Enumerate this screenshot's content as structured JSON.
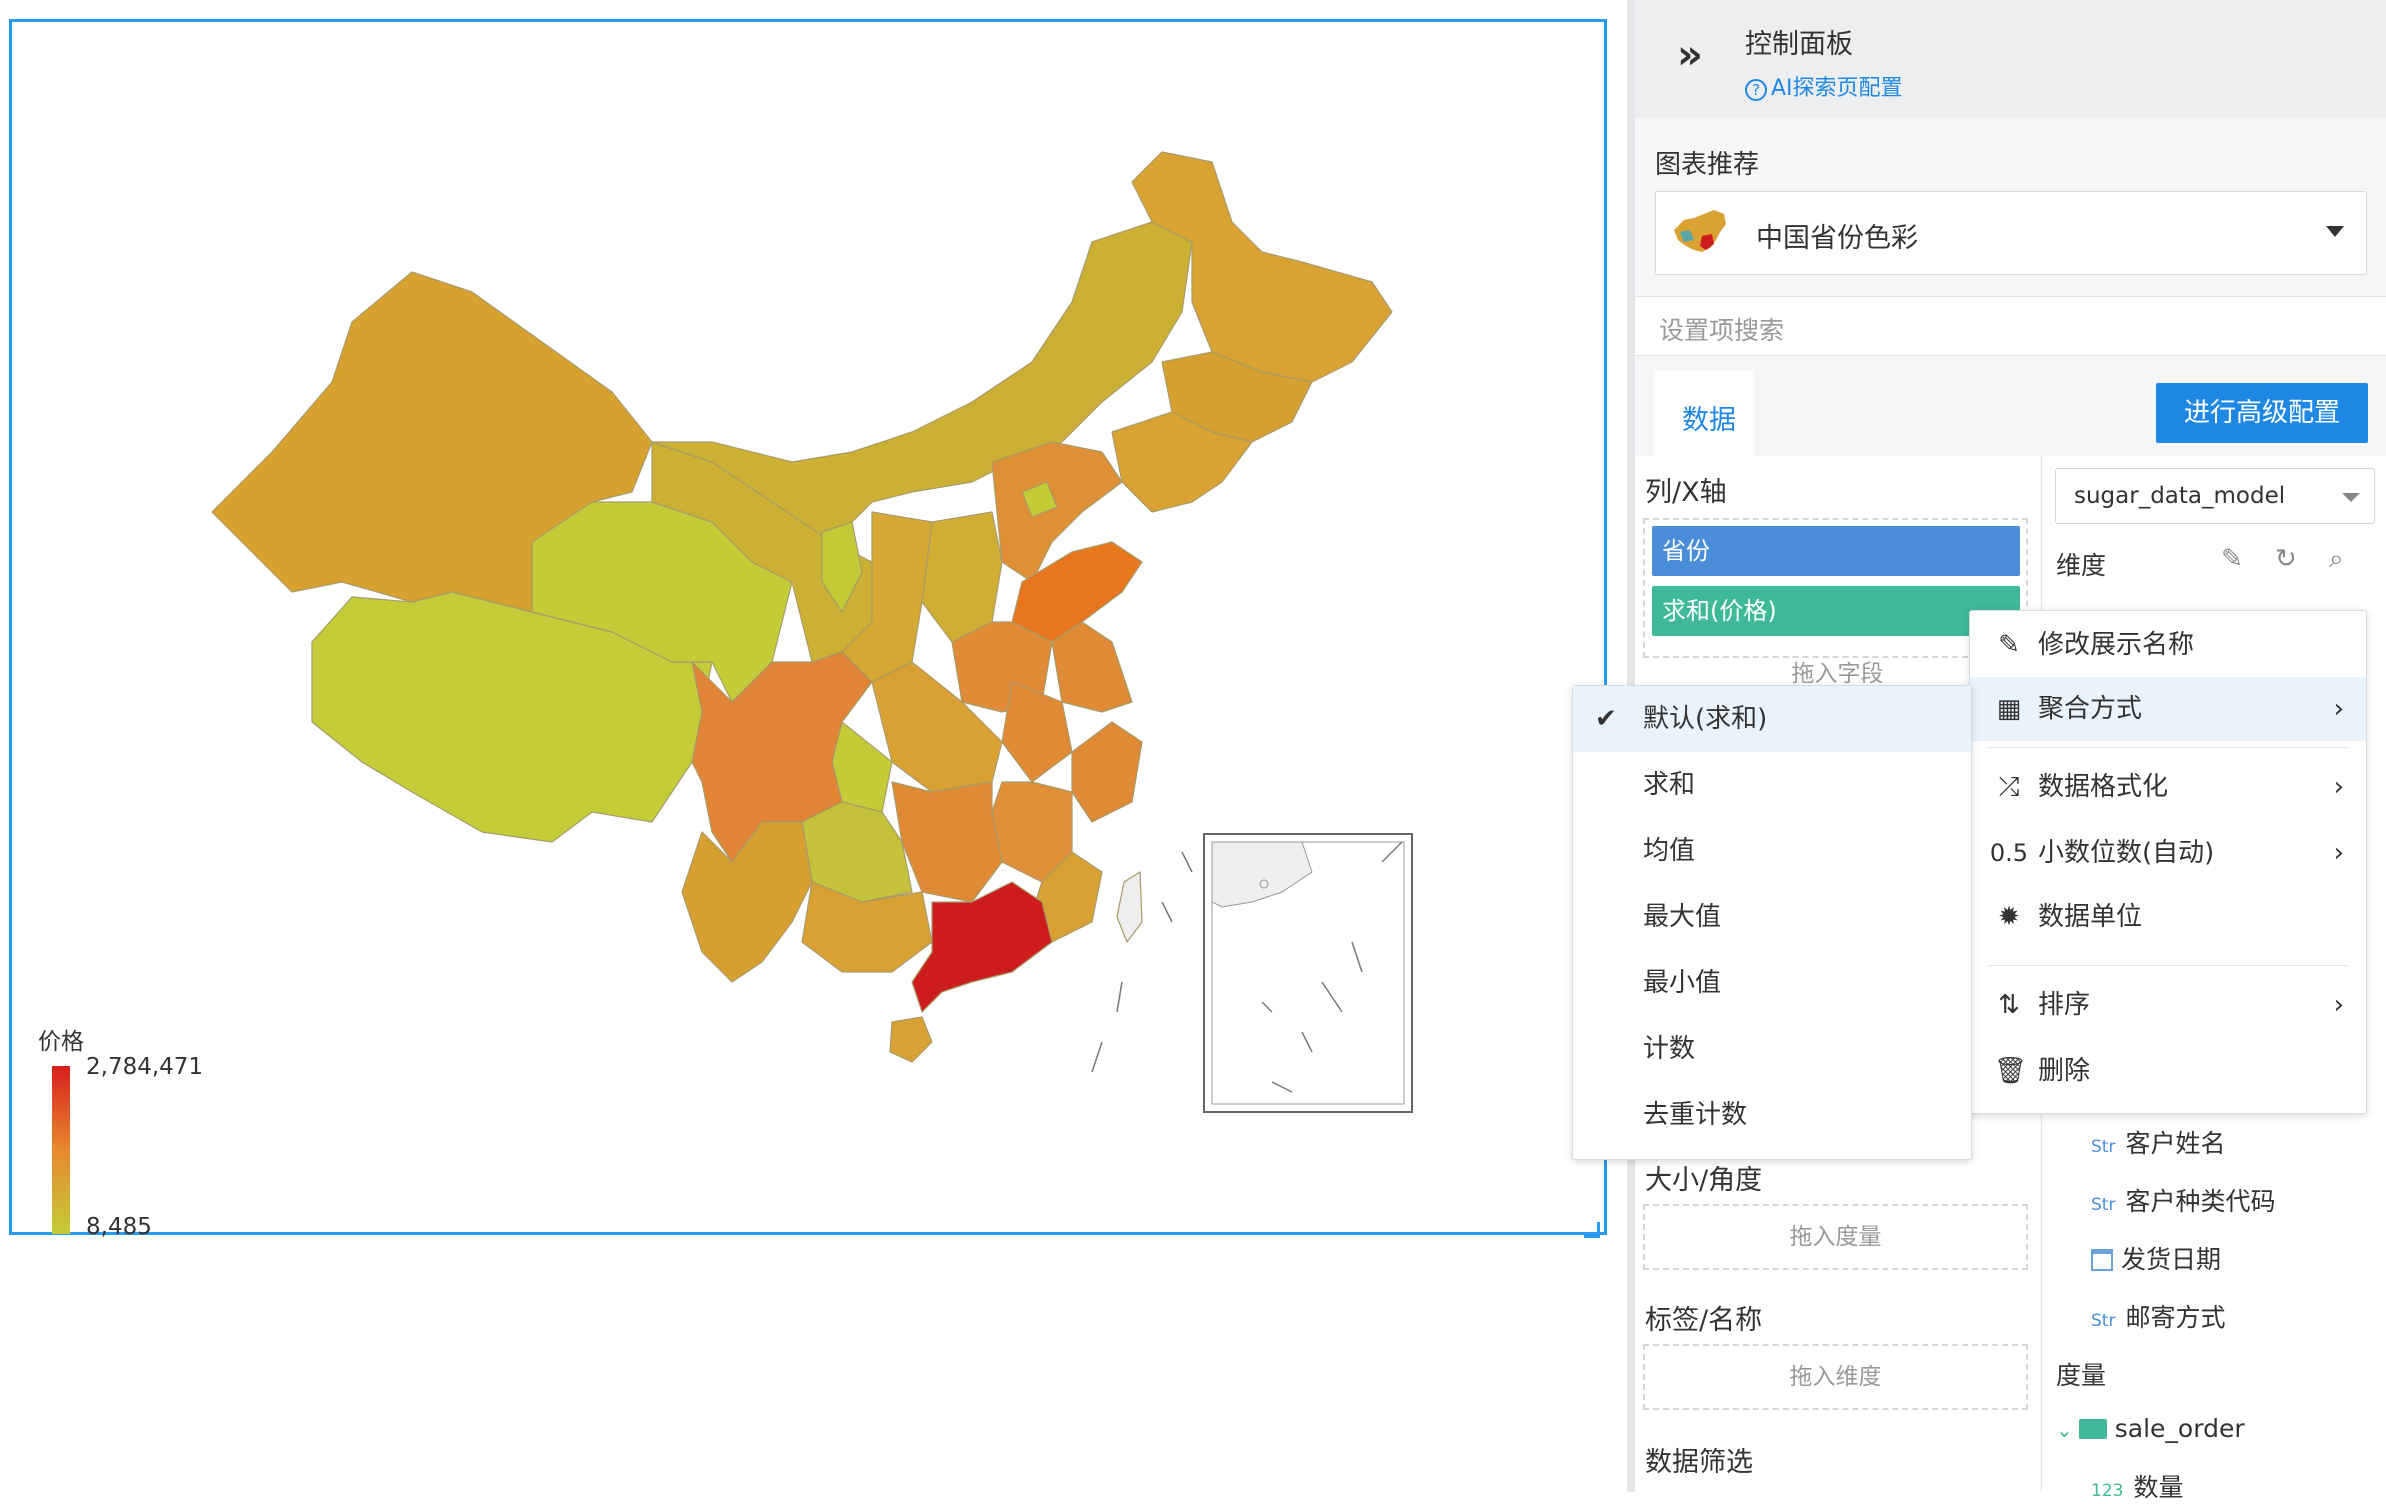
{
  "canvas": {
    "legend": {
      "title": "价格",
      "max": "2,784,471",
      "min": "8,485"
    },
    "chart_data": {
      "type": "heatmap",
      "subtype": "choropleth-map",
      "title": "",
      "legend_title": "价格",
      "range": [
        8485,
        2784471
      ],
      "color_scale": [
        "#c3cc37",
        "#e8892e",
        "#d81e1e"
      ],
      "regions": [
        {
          "name": "广东",
          "level": "max",
          "color": "#cc1c1c"
        },
        {
          "name": "山东",
          "level": "high",
          "color": "#e8761f"
        },
        {
          "name": "四川",
          "level": "high",
          "color": "#e28436"
        },
        {
          "name": "湖南",
          "level": "medium-high",
          "color": "#e08a36"
        },
        {
          "name": "江西",
          "level": "medium-high",
          "color": "#e09038"
        },
        {
          "name": "新疆",
          "level": "medium",
          "color": "#d7a12f"
        },
        {
          "name": "内蒙古",
          "level": "medium",
          "color": "#ccb034"
        },
        {
          "name": "黑龙江",
          "level": "medium",
          "color": "#d9a233"
        },
        {
          "name": "西藏",
          "level": "low",
          "color": "#c4cc37"
        },
        {
          "name": "青海",
          "level": "low",
          "color": "#c3cc37"
        },
        {
          "name": "宁夏",
          "level": "low",
          "color": "#c3cc37"
        },
        {
          "name": "北京",
          "level": "low",
          "color": "#c3cc37"
        },
        {
          "name": "重庆",
          "level": "low",
          "color": "#c3cc37"
        },
        {
          "name": "贵州",
          "level": "low-medium",
          "color": "#c4c23a"
        },
        {
          "name": "云南",
          "level": "medium",
          "color": "#d79e30"
        },
        {
          "name": "广西",
          "level": "medium",
          "color": "#d9a133"
        },
        {
          "name": "海南",
          "level": "medium",
          "color": "#d9a133"
        }
      ]
    }
  },
  "panel": {
    "title": "控制面板",
    "ai_link": "AI探索页配置",
    "recommend_label": "图表推荐",
    "recommend_value": "中国省份色彩",
    "search_placeholder": "设置项搜索",
    "tab_data": "数据",
    "adv_button": "进行高级配置",
    "col_x_label": "列/X轴",
    "pill_province": "省份",
    "pill_sum": "求和(价格)",
    "drop_field": "拖入字段",
    "size_angle_label": "大小/角度",
    "drop_measure": "拖入度量",
    "tag_label": "标签/名称",
    "drop_dimension": "拖入维度",
    "filter_label": "数据筛选",
    "model": "sugar_data_model",
    "dimension_label": "维度",
    "fields": [
      {
        "type": "Str",
        "name": "客户姓名"
      },
      {
        "type": "Str",
        "name": "客户种类代码"
      },
      {
        "type": "date",
        "name": "发货日期"
      },
      {
        "type": "Str",
        "name": "邮寄方式"
      }
    ],
    "measure_label": "度量",
    "measure_group": "sale_order",
    "measure_item": {
      "type": "123",
      "name": "数量"
    }
  },
  "context_menu": {
    "items": [
      {
        "icon": "edit-icon",
        "label": "修改展示名称"
      },
      {
        "icon": "calculator-icon",
        "label": "聚合方式",
        "submenu": true
      },
      {
        "icon": "shuffle-icon",
        "label": "数据格式化",
        "submenu": true
      },
      {
        "icon": "decimal-icon",
        "glyph": "0.5",
        "label": "小数位数(自动)",
        "submenu": true
      },
      {
        "icon": "gear-icon",
        "label": "数据单位"
      },
      {
        "icon": "sort-icon",
        "label": "排序",
        "submenu": true
      },
      {
        "icon": "trash-icon",
        "label": "删除"
      }
    ]
  },
  "aggregation_submenu": {
    "selected": "默认(求和)",
    "items": [
      "默认(求和)",
      "求和",
      "均值",
      "最大值",
      "最小值",
      "计数",
      "去重计数"
    ]
  }
}
